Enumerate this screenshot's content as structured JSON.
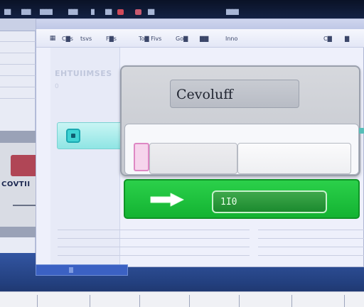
{
  "topbar": {
    "items": [
      "▇▇",
      "▇▇▇",
      "▇▇▇▇",
      "▇▇▇",
      "▇",
      "▇▇",
      "▇▇▇▇"
    ],
    "indicator_colors": [
      "#d14a5a",
      "#c85a70"
    ]
  },
  "left_window": {
    "tab_label": "",
    "bottom_text": "COVTII"
  },
  "main_window": {
    "menu": [
      "C▇s",
      "tsvs",
      "F▇s",
      "To▇ Fivs",
      "Go▇",
      "▇▇",
      "Inno",
      "C▇",
      "▇"
    ],
    "sidebar_title": "EHTUIIMSES",
    "sidebar_sub": "0"
  },
  "dialog": {
    "title": "Cevoluff",
    "field_left_value": "",
    "field_1_value": "",
    "field_2_value": ""
  },
  "action_bar": {
    "label": "1I0",
    "arrow_icon": "arrow-right-icon"
  },
  "colors": {
    "accent_green": "#13b332",
    "accent_cyan": "#3fd3d3",
    "accent_pink": "#de88c4",
    "dialog_bg": "#c4c7ce"
  }
}
